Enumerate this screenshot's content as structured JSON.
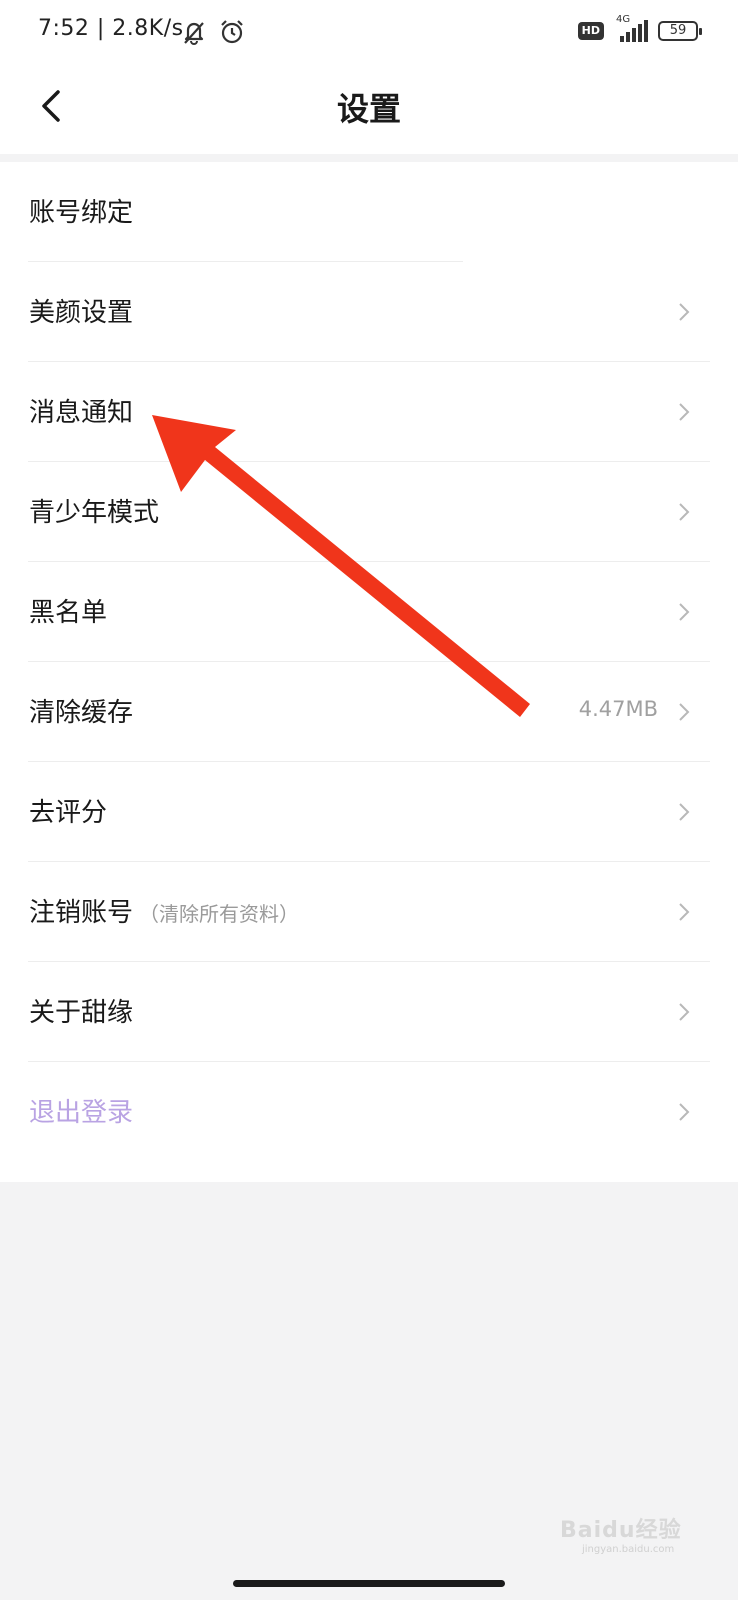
{
  "status_bar": {
    "time": "7:52 | 2.8K/s",
    "hd_label": "HD",
    "network_label": "4G",
    "battery": "59"
  },
  "header": {
    "title": "设置"
  },
  "settings": {
    "items": [
      {
        "label": "账号绑定",
        "note": "",
        "value": "",
        "chevron": false
      },
      {
        "label": "美颜设置",
        "note": "",
        "value": "",
        "chevron": true
      },
      {
        "label": "消息通知",
        "note": "",
        "value": "",
        "chevron": true
      },
      {
        "label": "青少年模式",
        "note": "",
        "value": "",
        "chevron": true
      },
      {
        "label": "黑名单",
        "note": "",
        "value": "",
        "chevron": true
      },
      {
        "label": "清除缓存",
        "note": "",
        "value": "4.47MB",
        "chevron": true
      },
      {
        "label": "去评分",
        "note": "",
        "value": "",
        "chevron": true
      },
      {
        "label": "注销账号",
        "note": "（清除所有资料）",
        "value": "",
        "chevron": true
      },
      {
        "label": "关于甜缘",
        "note": "",
        "value": "",
        "chevron": true
      },
      {
        "label": "退出登录",
        "note": "",
        "value": "",
        "chevron": true
      }
    ]
  },
  "watermark": {
    "brand": "Baidu经验",
    "url": "jingyan.baidu.com"
  },
  "colors": {
    "logout": "#b9a3e3",
    "arrow": "#f0351b"
  }
}
